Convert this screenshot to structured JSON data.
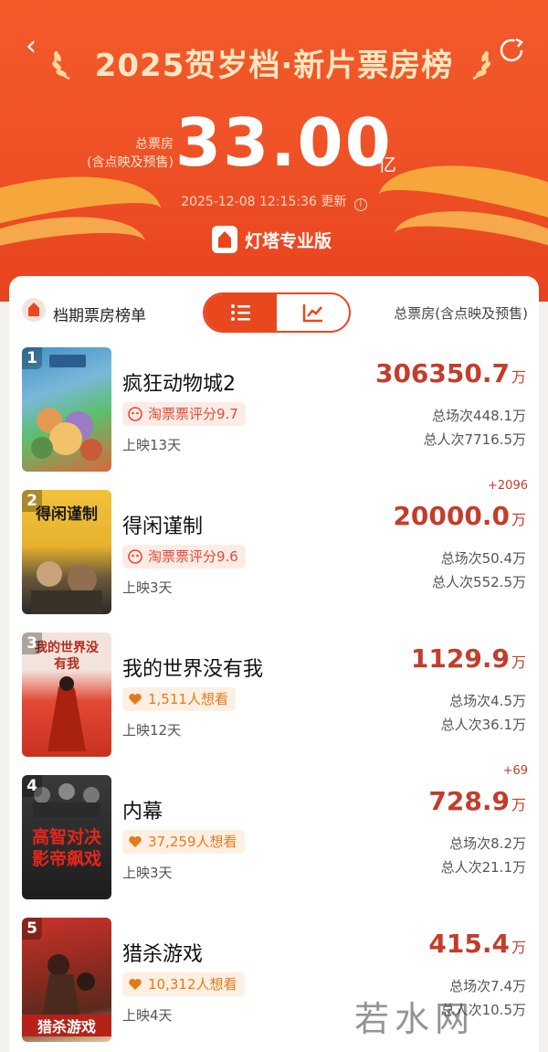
{
  "header": {
    "title": "2025贺岁档·新片票房榜",
    "back_icon": "‹",
    "total_label_line1": "总票房",
    "total_label_line2": "(含点映及预售)",
    "total_value": "33.00",
    "total_unit": "亿",
    "updated_time": "2025-12-08 12:15:36",
    "updated_suffix": "更新",
    "brand": "灯塔专业版",
    "colors": {
      "primary": "#e9481f",
      "title_gold": "#ffe7c2",
      "ribbon": "#f7b13e"
    }
  },
  "panel": {
    "title": "档期票房榜单",
    "column_header": "总票房(含点映及预售)",
    "view_toggle": {
      "active": "list-icon",
      "inactive": "trend-chart-icon"
    }
  },
  "movies": [
    {
      "rank": "1",
      "poster_text": "",
      "title": "疯狂动物城2",
      "badge": "淘票票评分9.7",
      "badge_type": "rating",
      "days": "上映13天",
      "delta": "",
      "box_office": "306350.7",
      "unit": "万",
      "shows": "总场次448.1万",
      "viewers": "总人次7716.5万",
      "poster_colors": [
        "#3f8fc9",
        "#5bbf6b",
        "#d9693c"
      ]
    },
    {
      "rank": "2",
      "poster_text": "得闲谨制",
      "title": "得闲谨制",
      "badge": "淘票票评分9.6",
      "badge_type": "rating",
      "days": "上映3天",
      "delta": "+2096",
      "box_office": "20000.0",
      "unit": "万",
      "shows": "总场次50.4万",
      "viewers": "总人次552.5万",
      "poster_colors": [
        "#f0c23a",
        "#6b5a3a",
        "#2a2a2a"
      ]
    },
    {
      "rank": "3",
      "poster_text": "我的世界没有我",
      "title": "我的世界没有我",
      "badge": "1,511人想看",
      "badge_type": "want",
      "days": "上映12天",
      "delta": "",
      "box_office": "1129.9",
      "unit": "万",
      "shows": "总场次4.5万",
      "viewers": "总人次36.1万",
      "poster_colors": [
        "#e24a36",
        "#c8311f",
        "#f2e4dc"
      ]
    },
    {
      "rank": "4",
      "poster_text": "高智对决影帝飙戏",
      "title": "内幕",
      "badge": "37,259人想看",
      "badge_type": "want",
      "days": "上映3天",
      "delta": "+69",
      "box_office": "728.9",
      "unit": "万",
      "shows": "总场次8.2万",
      "viewers": "总人次21.1万",
      "poster_colors": [
        "#1d1d1d",
        "#3a3a3a",
        "#d8241c"
      ]
    },
    {
      "rank": "5",
      "poster_text": "猎杀游戏",
      "title": "猎杀游戏",
      "badge": "10,312人想看",
      "badge_type": "want",
      "days": "上映4天",
      "delta": "",
      "box_office": "415.4",
      "unit": "万",
      "shows": "总场次7.4万",
      "viewers": "总人次10.5万",
      "poster_colors": [
        "#c9322a",
        "#5a2a1e",
        "#e8c9a0"
      ]
    }
  ],
  "watermark": {
    "text": "若水网",
    "sub": "[ ]"
  }
}
